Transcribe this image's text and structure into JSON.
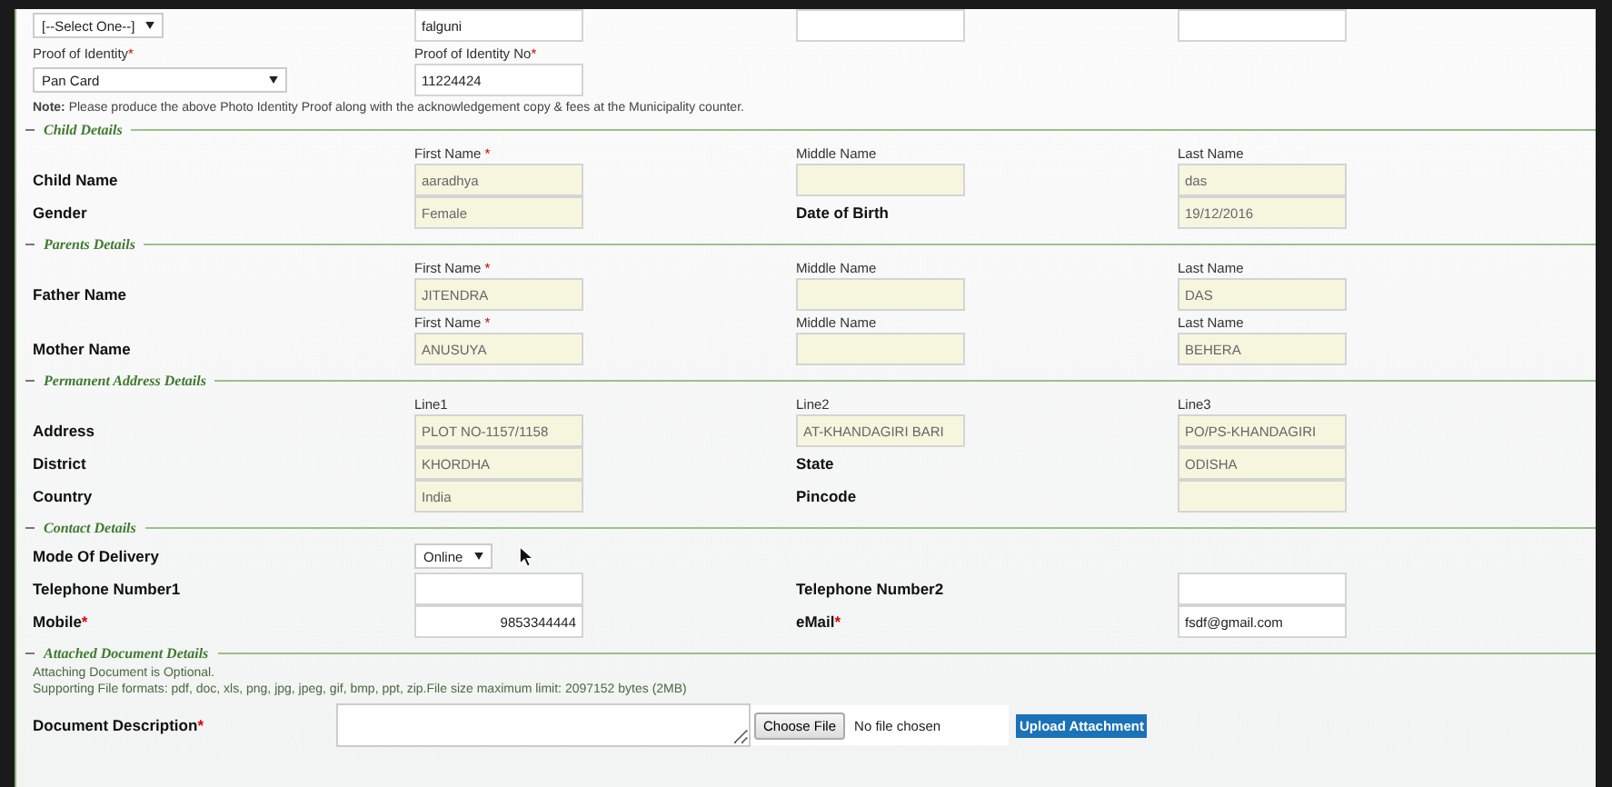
{
  "identity_rows": [
    {
      "cells": [
        {
          "kind": "select",
          "value": "[--Select One--]",
          "wide": false
        },
        {
          "kind": "field",
          "value": "falguni",
          "readonly": false
        },
        {
          "kind": "field",
          "readonly": false
        },
        {
          "kind": "field",
          "readonly": false
        }
      ]
    },
    {
      "cells": [
        {
          "kind": "sublabel",
          "text": "Proof of Identity",
          "mark": "*"
        },
        {
          "kind": "sublabel",
          "text": "Proof of Identity No",
          "mark": "*"
        },
        null,
        null
      ]
    },
    {
      "cells": [
        {
          "kind": "select",
          "value": "Pan Card",
          "wide": true
        },
        {
          "kind": "field",
          "value": "11224424",
          "readonly": false
        },
        null,
        null
      ]
    }
  ],
  "note": "**Note:** Please produce the above Photo Identity Proof along with the acknowledgement copy & fees at the Municipality counter.",
  "sections": [
    {
      "title": "Child Details",
      "rows": [
        {
          "cells": [
            null,
            {
              "kind": "sublabel",
              "text": "First Name ",
              "mark": "*"
            },
            {
              "kind": "sublabel",
              "text": "Middle Name"
            },
            {
              "kind": "sublabel",
              "text": "Last Name"
            }
          ]
        },
        {
          "cells": [
            {
              "kind": "label",
              "text": "Child Name"
            },
            {
              "kind": "field",
              "value": "aaradhya",
              "readonly": true
            },
            {
              "kind": "field",
              "readonly": true
            },
            {
              "kind": "field",
              "value": "das",
              "readonly": true
            }
          ]
        },
        {
          "cells": [
            {
              "kind": "label",
              "text": "Gender"
            },
            {
              "kind": "field",
              "value": "Female",
              "readonly": true
            },
            {
              "kind": "label",
              "text": "Date of Birth"
            },
            {
              "kind": "field",
              "value": "19/12/2016",
              "readonly": true
            }
          ]
        }
      ]
    },
    {
      "title": "Parents Details",
      "rows": [
        {
          "cells": [
            null,
            {
              "kind": "sublabel",
              "text": "First Name ",
              "mark": "*"
            },
            {
              "kind": "sublabel",
              "text": "Middle Name"
            },
            {
              "kind": "sublabel",
              "text": "Last Name"
            }
          ]
        },
        {
          "cells": [
            {
              "kind": "label",
              "text": "Father Name"
            },
            {
              "kind": "field",
              "value": "JITENDRA",
              "readonly": true
            },
            {
              "kind": "field",
              "readonly": true
            },
            {
              "kind": "field",
              "value": "DAS",
              "readonly": true
            }
          ]
        },
        {
          "cells": [
            null,
            {
              "kind": "sublabel",
              "text": "First Name ",
              "mark": "*"
            },
            {
              "kind": "sublabel",
              "text": "Middle Name"
            },
            {
              "kind": "sublabel",
              "text": "Last Name"
            }
          ]
        },
        {
          "cells": [
            {
              "kind": "label",
              "text": "Mother Name"
            },
            {
              "kind": "field",
              "value": "ANUSUYA",
              "readonly": true
            },
            {
              "kind": "field",
              "readonly": true
            },
            {
              "kind": "field",
              "value": "BEHERA",
              "readonly": true
            }
          ]
        }
      ]
    },
    {
      "title": "Permanent Address Details",
      "rows": [
        {
          "cells": [
            null,
            {
              "kind": "sublabel",
              "text": "Line1"
            },
            {
              "kind": "sublabel",
              "text": "Line2"
            },
            {
              "kind": "sublabel",
              "text": "Line3"
            }
          ]
        },
        {
          "cells": [
            {
              "kind": "label",
              "text": "Address"
            },
            {
              "kind": "field",
              "value": "PLOT NO-1157/1158",
              "readonly": true
            },
            {
              "kind": "field",
              "value": "AT-KHANDAGIRI BARI",
              "readonly": true
            },
            {
              "kind": "field",
              "value": "PO/PS-KHANDAGIRI",
              "readonly": true
            }
          ]
        },
        {
          "cells": [
            {
              "kind": "label",
              "text": "District"
            },
            {
              "kind": "field",
              "value": "KHORDHA",
              "readonly": true
            },
            {
              "kind": "label",
              "text": "State"
            },
            {
              "kind": "field",
              "value": "ODISHA",
              "readonly": true
            }
          ]
        },
        {
          "cells": [
            {
              "kind": "label",
              "text": "Country"
            },
            {
              "kind": "field",
              "value": "India",
              "readonly": true
            },
            {
              "kind": "label",
              "text": "Pincode"
            },
            {
              "kind": "field",
              "readonly": true
            }
          ]
        }
      ]
    },
    {
      "title": "Contact Details",
      "rows": [
        {
          "cells": [
            {
              "kind": "label",
              "text": "Mode Of Delivery"
            },
            {
              "kind": "select",
              "value": "Online",
              "wide": false,
              "cursor": true
            },
            null,
            null
          ]
        },
        {
          "cells": [
            {
              "kind": "label",
              "text": "Telephone Number1"
            },
            {
              "kind": "field",
              "readonly": false
            },
            {
              "kind": "label",
              "text": "Telephone Number2"
            },
            {
              "kind": "field",
              "readonly": false
            }
          ]
        },
        {
          "cells": [
            {
              "kind": "label",
              "text": "Mobile",
              "mark": "*"
            },
            {
              "kind": "field",
              "value": "9853344444",
              "readonly": false,
              "right_aligned": true
            },
            {
              "kind": "label",
              "text": "eMail",
              "mark": "*"
            },
            {
              "kind": "field",
              "value": "fsdf@gmail.com",
              "readonly": false
            }
          ]
        }
      ]
    }
  ],
  "attachments": {
    "title": "Attached Document Details",
    "notes": [
      "Attaching Document is Optional.",
      "Supporting File formats: pdf, doc, xls, png, jpg, jpeg, gif, bmp, ppt, zip.File size maximum limit: 2097152 bytes (2MB)"
    ],
    "label": {
      "text": "Document Description",
      "mark": "*"
    },
    "choose_button": "Choose File",
    "file_status": "No file chosen",
    "upload_button": "Upload Attachment"
  }
}
